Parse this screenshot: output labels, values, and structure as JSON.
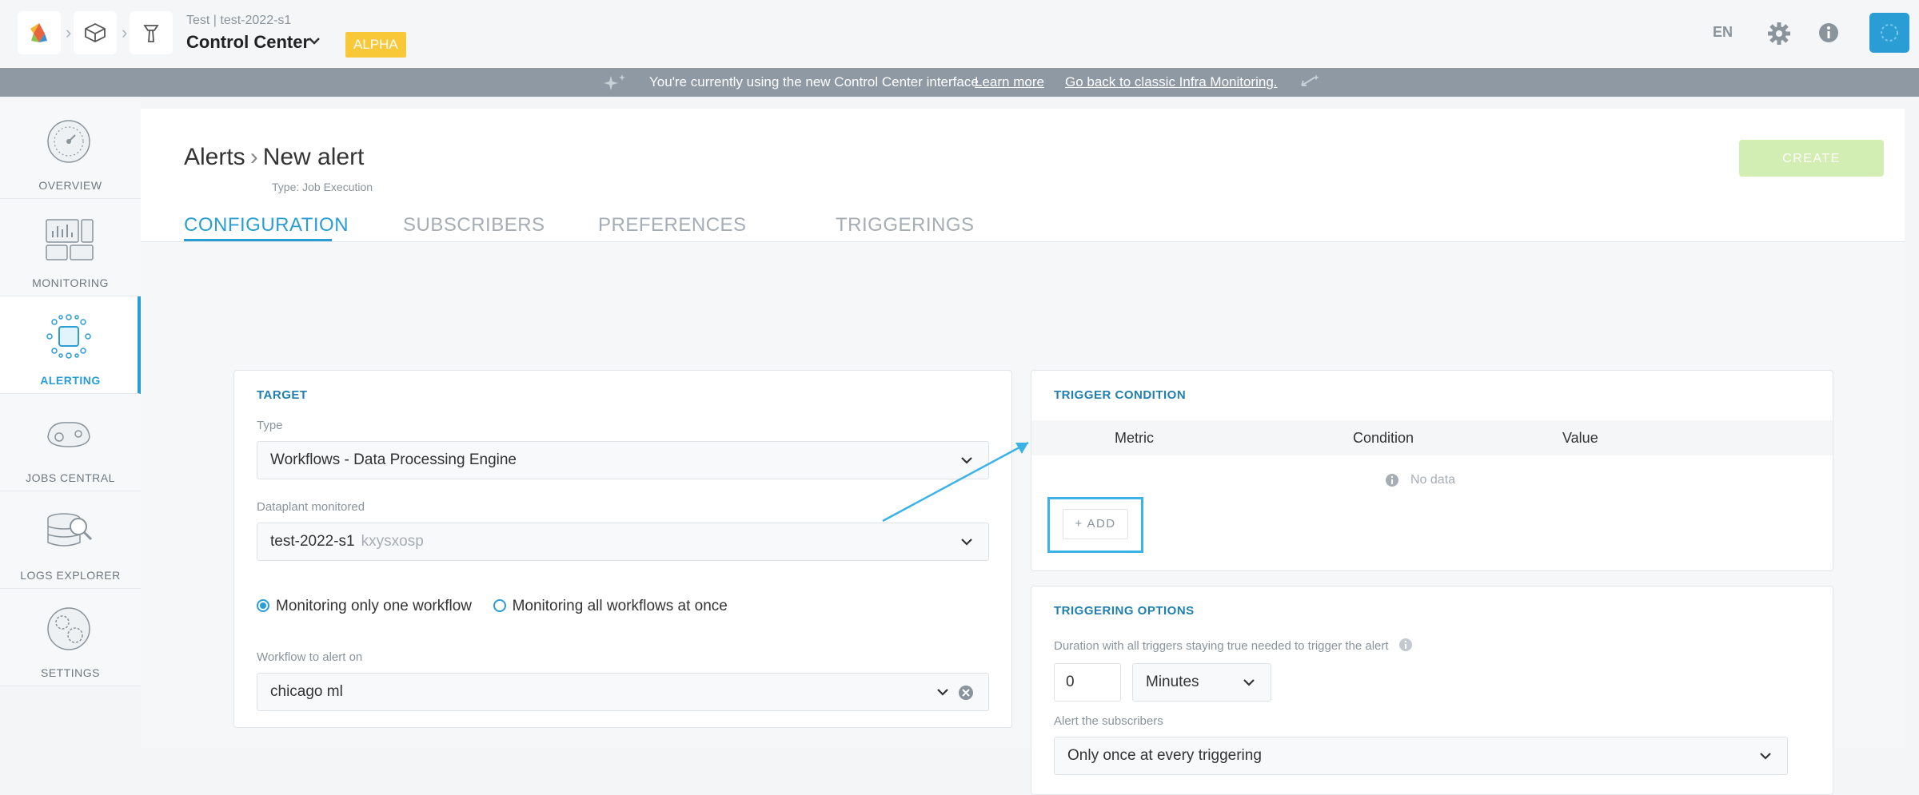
{
  "header": {
    "breadcrumb_small": "Test | test-2022-s1",
    "app_title": "Control Center",
    "badge": "ALPHA",
    "language": "EN"
  },
  "banner": {
    "message": "You're currently using the new Control Center interface.",
    "learn_more": "Learn more",
    "go_back": "Go back to classic Infra Monitoring."
  },
  "sidebar": {
    "items": [
      {
        "label": "OVERVIEW",
        "icon": "gauge-icon"
      },
      {
        "label": "MONITORING",
        "icon": "monitoring-icon"
      },
      {
        "label": "ALERTING",
        "icon": "alerting-icon",
        "active": true
      },
      {
        "label": "JOBS CENTRAL",
        "icon": "jobs-icon"
      },
      {
        "label": "LOGS EXPLORER",
        "icon": "logs-icon"
      },
      {
        "label": "SETTINGS",
        "icon": "settings-icon"
      }
    ]
  },
  "page": {
    "title_parent": "Alerts",
    "title_current": "New alert",
    "subtitle": "Type: Job Execution",
    "create_label": "CREATE",
    "tabs": [
      {
        "label": "CONFIGURATION",
        "active": true
      },
      {
        "label": "SUBSCRIBERS"
      },
      {
        "label": "PREFERENCES"
      },
      {
        "label": "TRIGGERINGS"
      }
    ]
  },
  "target": {
    "title": "TARGET",
    "type_label": "Type",
    "type_value": "Workflows - Data Processing Engine",
    "dataplant_label": "Dataplant monitored",
    "dataplant_value": "test-2022-s1",
    "dataplant_id": "kxysxosp",
    "radio_one": "Monitoring only one workflow",
    "radio_all": "Monitoring all workflows at once",
    "workflow_label": "Workflow to alert on",
    "workflow_value": "chicago ml"
  },
  "trigger_condition": {
    "title": "TRIGGER CONDITION",
    "columns": [
      "Metric",
      "Condition",
      "Value"
    ],
    "empty": "No data",
    "add_label": "+ ADD"
  },
  "triggering_options": {
    "title": "TRIGGERING OPTIONS",
    "duration_label": "Duration with all triggers staying true needed to trigger the alert",
    "duration_value": "0",
    "unit": "Minutes",
    "alert_label": "Alert the subscribers",
    "alert_value": "Only once at every triggering"
  },
  "colors": {
    "accent": "#2a9ed4",
    "badge": "#f9c838",
    "create_disabled": "#d3eeb2",
    "highlight": "#3bb3e6"
  }
}
